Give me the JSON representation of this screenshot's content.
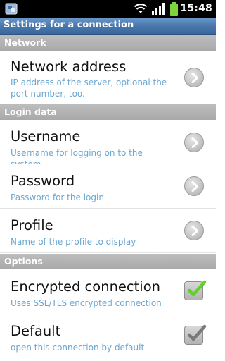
{
  "status_bar": {
    "time": "15:48"
  },
  "title": "Settings for a connection",
  "sections": {
    "network": {
      "header": "Network",
      "items": [
        {
          "title": "Network address",
          "summary": "IP address of the server, optional the port number, too."
        }
      ]
    },
    "login": {
      "header": "Login data",
      "items": [
        {
          "title": "Username",
          "summary": "Username for logging on to the system"
        },
        {
          "title": "Password",
          "summary": "Password for the login"
        },
        {
          "title": "Profile",
          "summary": "Name of the profile to display"
        }
      ]
    },
    "options": {
      "header": "Options",
      "items": [
        {
          "title": "Encrypted connection",
          "summary": "Uses SSL/TLS encrypted connection",
          "checked": true,
          "check_color": "#5fd12a"
        },
        {
          "title": "Default",
          "summary": "open this connection by default",
          "checked": true,
          "check_color": "#7a7a7a"
        }
      ]
    }
  }
}
